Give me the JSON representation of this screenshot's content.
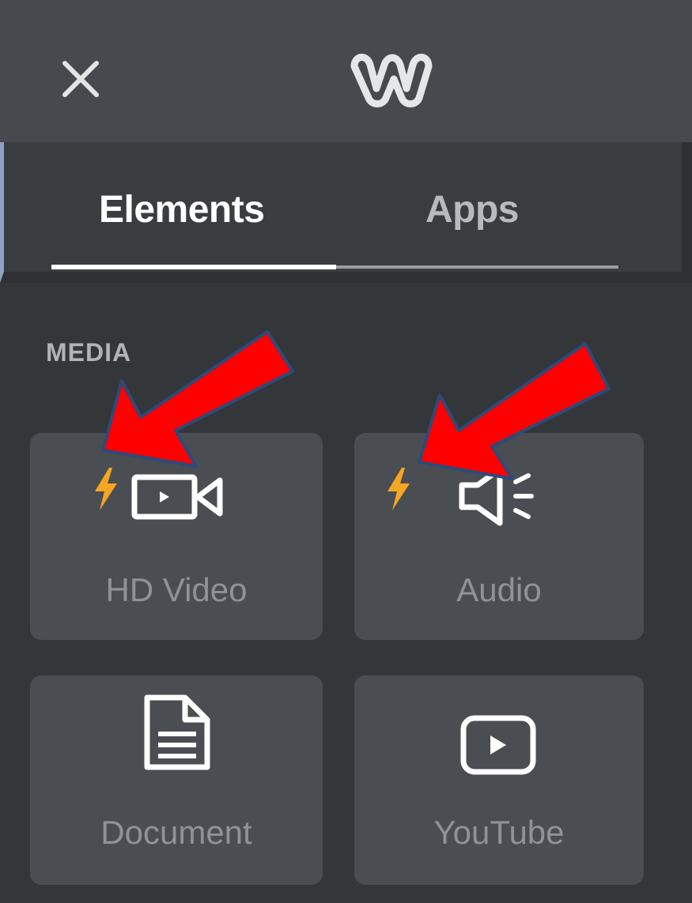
{
  "header": {
    "close_icon": "close-icon",
    "logo_icon": "weebly-logo-icon"
  },
  "tabs": [
    {
      "label": "Elements",
      "active": true
    },
    {
      "label": "Apps",
      "active": false
    }
  ],
  "section": {
    "title": "MEDIA"
  },
  "elements": [
    {
      "label": "HD Video",
      "icon": "video-camera-icon",
      "premium": true
    },
    {
      "label": "Audio",
      "icon": "speaker-icon",
      "premium": true
    },
    {
      "label": "Document",
      "icon": "document-icon",
      "premium": false
    },
    {
      "label": "YouTube",
      "icon": "youtube-play-icon",
      "premium": false
    }
  ],
  "colors": {
    "background": "#34373a",
    "header": "#464a4e",
    "card": "#4a4e52",
    "premium_bolt": "#f5a623",
    "annotation_arrow": "#ff0000"
  }
}
